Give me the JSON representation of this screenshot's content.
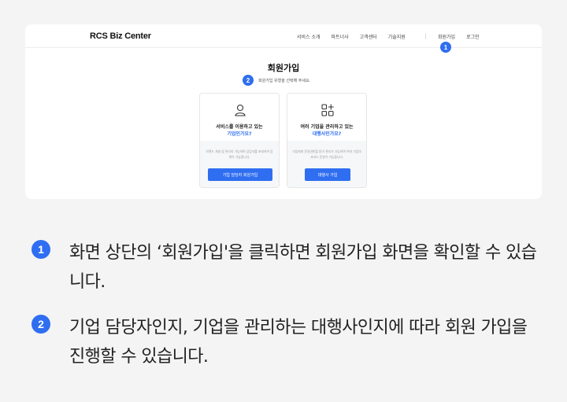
{
  "screen": {
    "logo": "RCS Biz Center",
    "nav_items": [
      "서비스 소개",
      "파트너사",
      "고객센터",
      "기술지원"
    ],
    "nav_right": [
      "회원가입",
      "로그인"
    ],
    "title": "회원가입",
    "subtitle": "회원가입 유형을 선택해 주세요.",
    "cards": [
      {
        "icon": "person-icon",
        "question_line1": "서비스를 이용하고 있는",
        "question_line2": "기업인가요?",
        "description": "브랜드 개설 및 관리의 가능하며 담당자를 초대하여 등록이 가능합니다.",
        "button": "기업 담당자 회원가입"
      },
      {
        "icon": "grid-plus-icon",
        "question_line1": "여러 기업을 관리하고 있는",
        "question_line2": "대행사인가요?",
        "description": "기업에게 운영권한을 받아 관리가 가능하며 여러 기업의 서비스 운영이 가능합니다.",
        "button": "대행사 가입"
      }
    ]
  },
  "markers": [
    "1",
    "2"
  ],
  "instructions": [
    {
      "number": "1",
      "text": "화면 상단의 ‘회원가입'을 클릭하면 회원가입 화면을 확인할 수 있습니다."
    },
    {
      "number": "2",
      "text": "기업 담당자인지, 기업을 관리하는 대행사인지에 따라 회원 가입을 진행할 수 있습니다."
    }
  ],
  "colors": {
    "accent": "#2f6ef0",
    "background": "#f4f4f5"
  }
}
